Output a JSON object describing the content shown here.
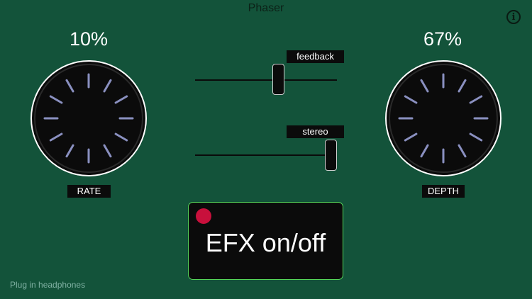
{
  "app": {
    "title": "Phaser",
    "info_icon": "info-circle-icon",
    "info_glyph": "i"
  },
  "rate": {
    "label": "RATE",
    "value": "10%",
    "percent": 10
  },
  "depth": {
    "label": "DEPTH",
    "value": "67%",
    "percent": 67
  },
  "feedback": {
    "label": "feedback",
    "level": 0.63
  },
  "stereo": {
    "label": "stereo",
    "level": 1.0
  },
  "efx": {
    "label": "EFX on/off",
    "indicator_color": "#c8103c",
    "state": "on"
  },
  "status": {
    "hint": "Plug in headphones"
  },
  "colors": {
    "background": "#13533a",
    "knob_face": "#0b0b0b",
    "knob_ticks": "#8a90c0",
    "button_border": "#55d65a",
    "indicator": "#c8103c"
  }
}
